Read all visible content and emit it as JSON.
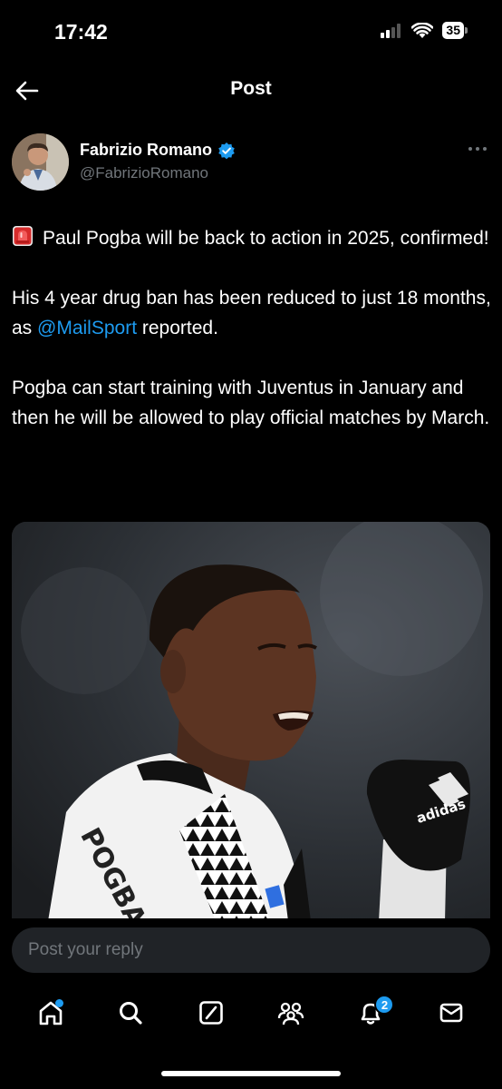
{
  "status_bar": {
    "time": "17:42",
    "battery": "35"
  },
  "header": {
    "title": "Post"
  },
  "author": {
    "name": "Fabrizio Romano",
    "handle": "@FabrizioRomano"
  },
  "post": {
    "paragraph1_text": "Paul Pogba will be back to action in 2025, confirmed!",
    "paragraph2_before": "His 4 year drug ban has been reduced to just 18 months, as ",
    "paragraph2_mention": "@MailSport",
    "paragraph2_after": " reported.",
    "paragraph3": "Pogba can start training with Juventus in January and then he will be allowed to play official matches by March.",
    "image": {
      "kit_text": "POGBA",
      "glove_logo": "adidas"
    }
  },
  "reply": {
    "placeholder": "Post your reply"
  },
  "nav": {
    "items": [
      {
        "name": "home",
        "icon": "home-icon"
      },
      {
        "name": "search",
        "icon": "search-icon"
      },
      {
        "name": "grok",
        "icon": "grok-icon"
      },
      {
        "name": "communities",
        "icon": "communities-icon"
      },
      {
        "name": "notifications",
        "icon": "bell-icon",
        "badge": "2"
      },
      {
        "name": "messages",
        "icon": "envelope-icon"
      }
    ]
  },
  "colors": {
    "background": "#000000",
    "accent": "#1d9bf0",
    "secondary_text": "#71767b"
  }
}
